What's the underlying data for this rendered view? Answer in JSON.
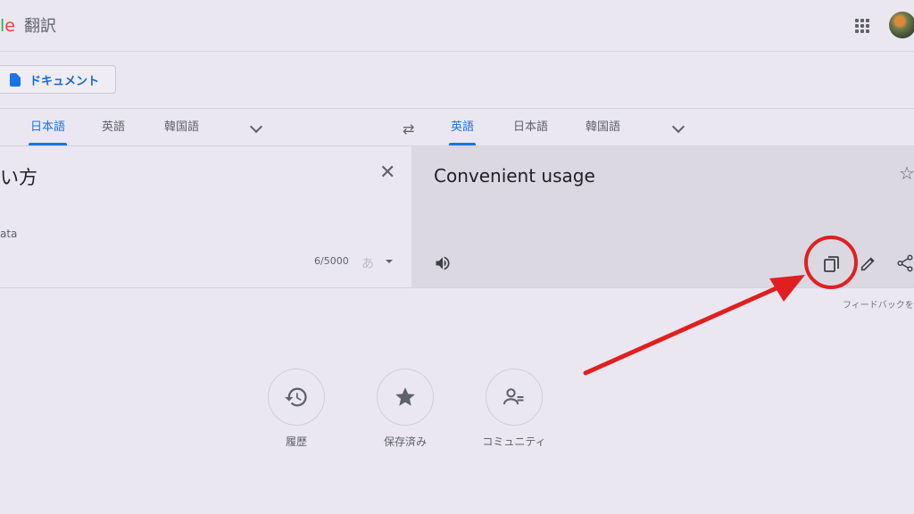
{
  "header": {
    "logo_fragment_1": "l",
    "logo_fragment_2": "e",
    "app_title": "翻訳",
    "apps_icon": "apps-grid-icon",
    "avatar_icon": "user-avatar"
  },
  "mode_button": {
    "label": "ドキュメント",
    "icon": "document-icon"
  },
  "source_langs": {
    "tabs": [
      "日本語",
      "英語",
      "韓国語"
    ],
    "active": "日本語"
  },
  "target_langs": {
    "tabs": [
      "英語",
      "日本語",
      "韓国語"
    ],
    "active": "英語"
  },
  "source": {
    "text": "い方",
    "romanization": "ata",
    "char_count": "6/5000",
    "ime_label": "あ"
  },
  "target": {
    "text": "Convenient usage",
    "feedback_label": "フィードバックを"
  },
  "bottom_actions": [
    {
      "label": "履歴",
      "icon": "history-icon"
    },
    {
      "label": "保存済み",
      "icon": "star-icon"
    },
    {
      "label": "コミュニティ",
      "icon": "community-icon"
    }
  ],
  "colors": {
    "accent": "#1a73e8",
    "annotation_red": "#e02020",
    "background": "#ebe7f1"
  }
}
